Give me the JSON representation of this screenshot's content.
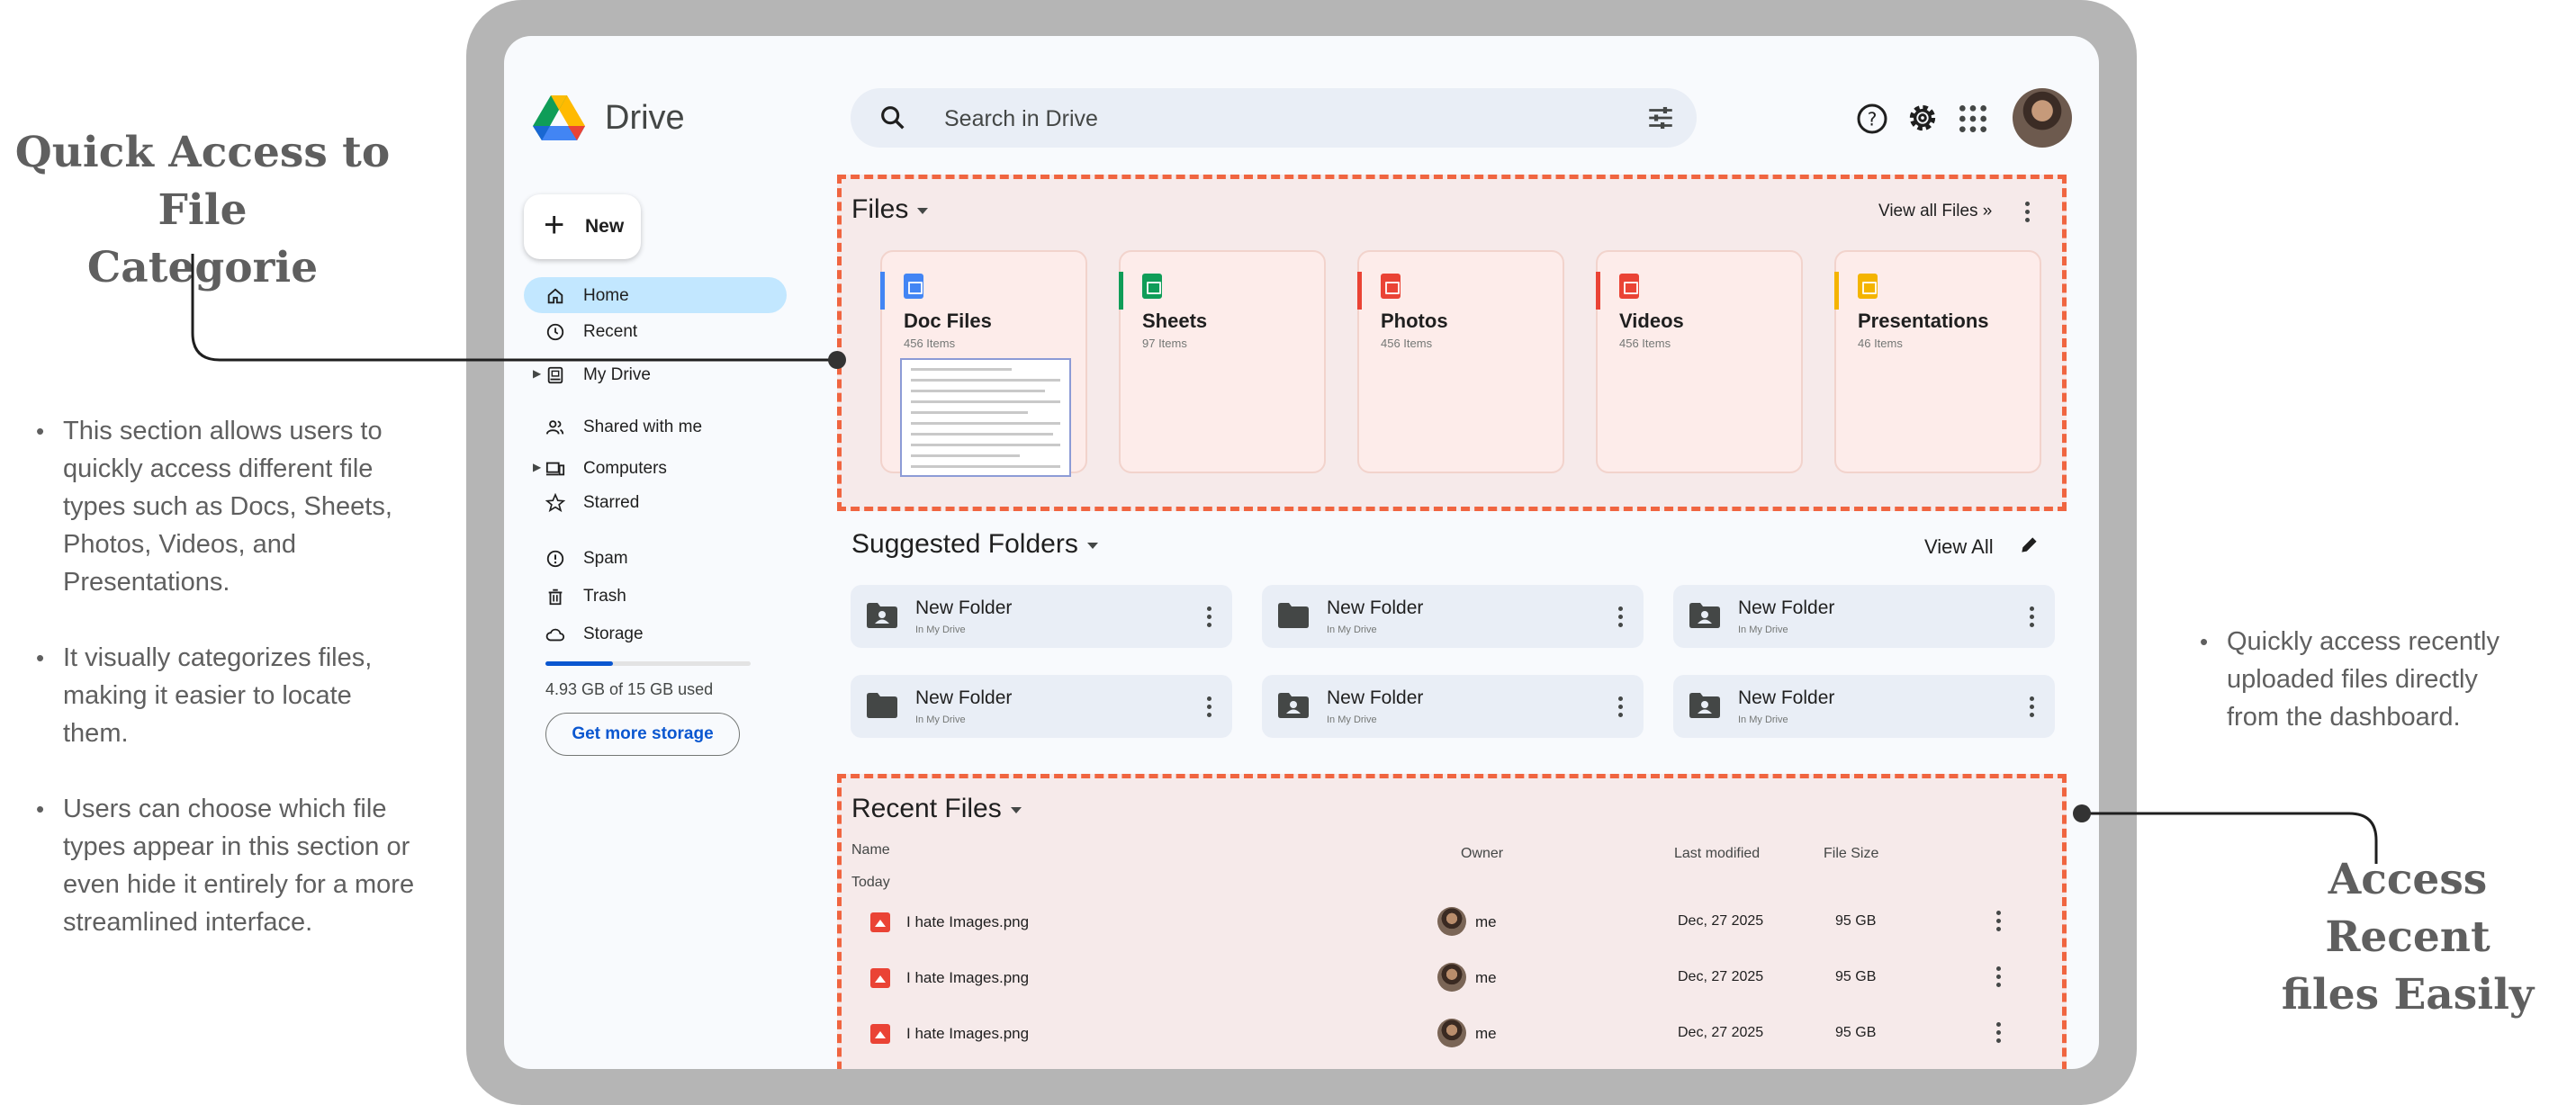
{
  "annotations": {
    "left_title": [
      "Quick Access to File",
      "Categorie"
    ],
    "left_bullets": [
      [
        "This section allows users to",
        "quickly access different file",
        "types such as Docs, Sheets,",
        "Photos, Videos, and",
        "Presentations."
      ],
      [
        "It visually categorizes files,",
        "making it easier to locate",
        "them."
      ],
      [
        "Users can choose which file",
        "types appear in this section or",
        "even hide it entirely for a more",
        "streamlined interface."
      ]
    ],
    "right_bullets": [
      [
        "Quickly access recently",
        "uploaded files directly",
        "from the dashboard."
      ]
    ],
    "right_title": [
      "Access Recent",
      "files Easily"
    ],
    "accent_color": "#f06540"
  },
  "app": {
    "name": "Drive",
    "search_placeholder": "Search in Drive"
  },
  "toolbar_icons": [
    "search-icon",
    "filter-icon",
    "help-icon",
    "settings-icon",
    "apps-icon"
  ],
  "sidebar": {
    "new_label": "New",
    "items": [
      {
        "label": "Home",
        "icon": "home-icon",
        "active": true
      },
      {
        "label": "Recent",
        "icon": "clock-icon"
      },
      {
        "label": "My Drive",
        "icon": "my-drive-icon",
        "expandable": true
      },
      {
        "label": "Shared with me",
        "icon": "people-icon"
      },
      {
        "label": "Computers",
        "icon": "computers-icon",
        "expandable": true
      },
      {
        "label": "Starred",
        "icon": "star-icon"
      },
      {
        "label": "Spam",
        "icon": "spam-icon"
      },
      {
        "label": "Trash",
        "icon": "trash-icon"
      },
      {
        "label": "Storage",
        "icon": "cloud-icon"
      }
    ],
    "storage_used": 0.329,
    "storage_text": "4.93 GB of 15 GB used",
    "get_more": "Get more storage"
  },
  "files": {
    "title": "Files",
    "view_all": "View all Files »",
    "categories": [
      {
        "name": "Doc Files",
        "count": "456 Items",
        "color": "#4285f4"
      },
      {
        "name": "Sheets",
        "count": "97 Items",
        "color": "#0f9d58"
      },
      {
        "name": "Photos",
        "count": "456 Items",
        "color": "#ea4335"
      },
      {
        "name": "Videos",
        "count": "456 Items",
        "color": "#ea4335"
      },
      {
        "name": "Presentations",
        "count": "46 Items",
        "color": "#f4b400"
      }
    ]
  },
  "suggested": {
    "title": "Suggested Folders",
    "view_all": "View All",
    "folders": [
      {
        "name": "New Folder",
        "sub": "In My Drive",
        "shared": true
      },
      {
        "name": "New Folder",
        "sub": "In My Drive",
        "shared": false
      },
      {
        "name": "New Folder",
        "sub": "In My Drive",
        "shared": true
      },
      {
        "name": "New Folder",
        "sub": "In My Drive",
        "shared": false
      },
      {
        "name": "New Folder",
        "sub": "In My Drive",
        "shared": true
      },
      {
        "name": "New Folder",
        "sub": "In My Drive",
        "shared": true
      }
    ]
  },
  "recent": {
    "title": "Recent Files",
    "columns": {
      "name": "Name",
      "owner": "Owner",
      "modified": "Last modified",
      "size": "File Size"
    },
    "group": "Today",
    "rows": [
      {
        "name": "I hate Images.png",
        "owner": "me",
        "modified": "Dec, 27 2025",
        "size": "95 GB"
      },
      {
        "name": "I hate Images.png",
        "owner": "me",
        "modified": "Dec, 27 2025",
        "size": "95 GB"
      },
      {
        "name": "I hate Images.png",
        "owner": "me",
        "modified": "Dec, 27 2025",
        "size": "95 GB"
      }
    ]
  }
}
